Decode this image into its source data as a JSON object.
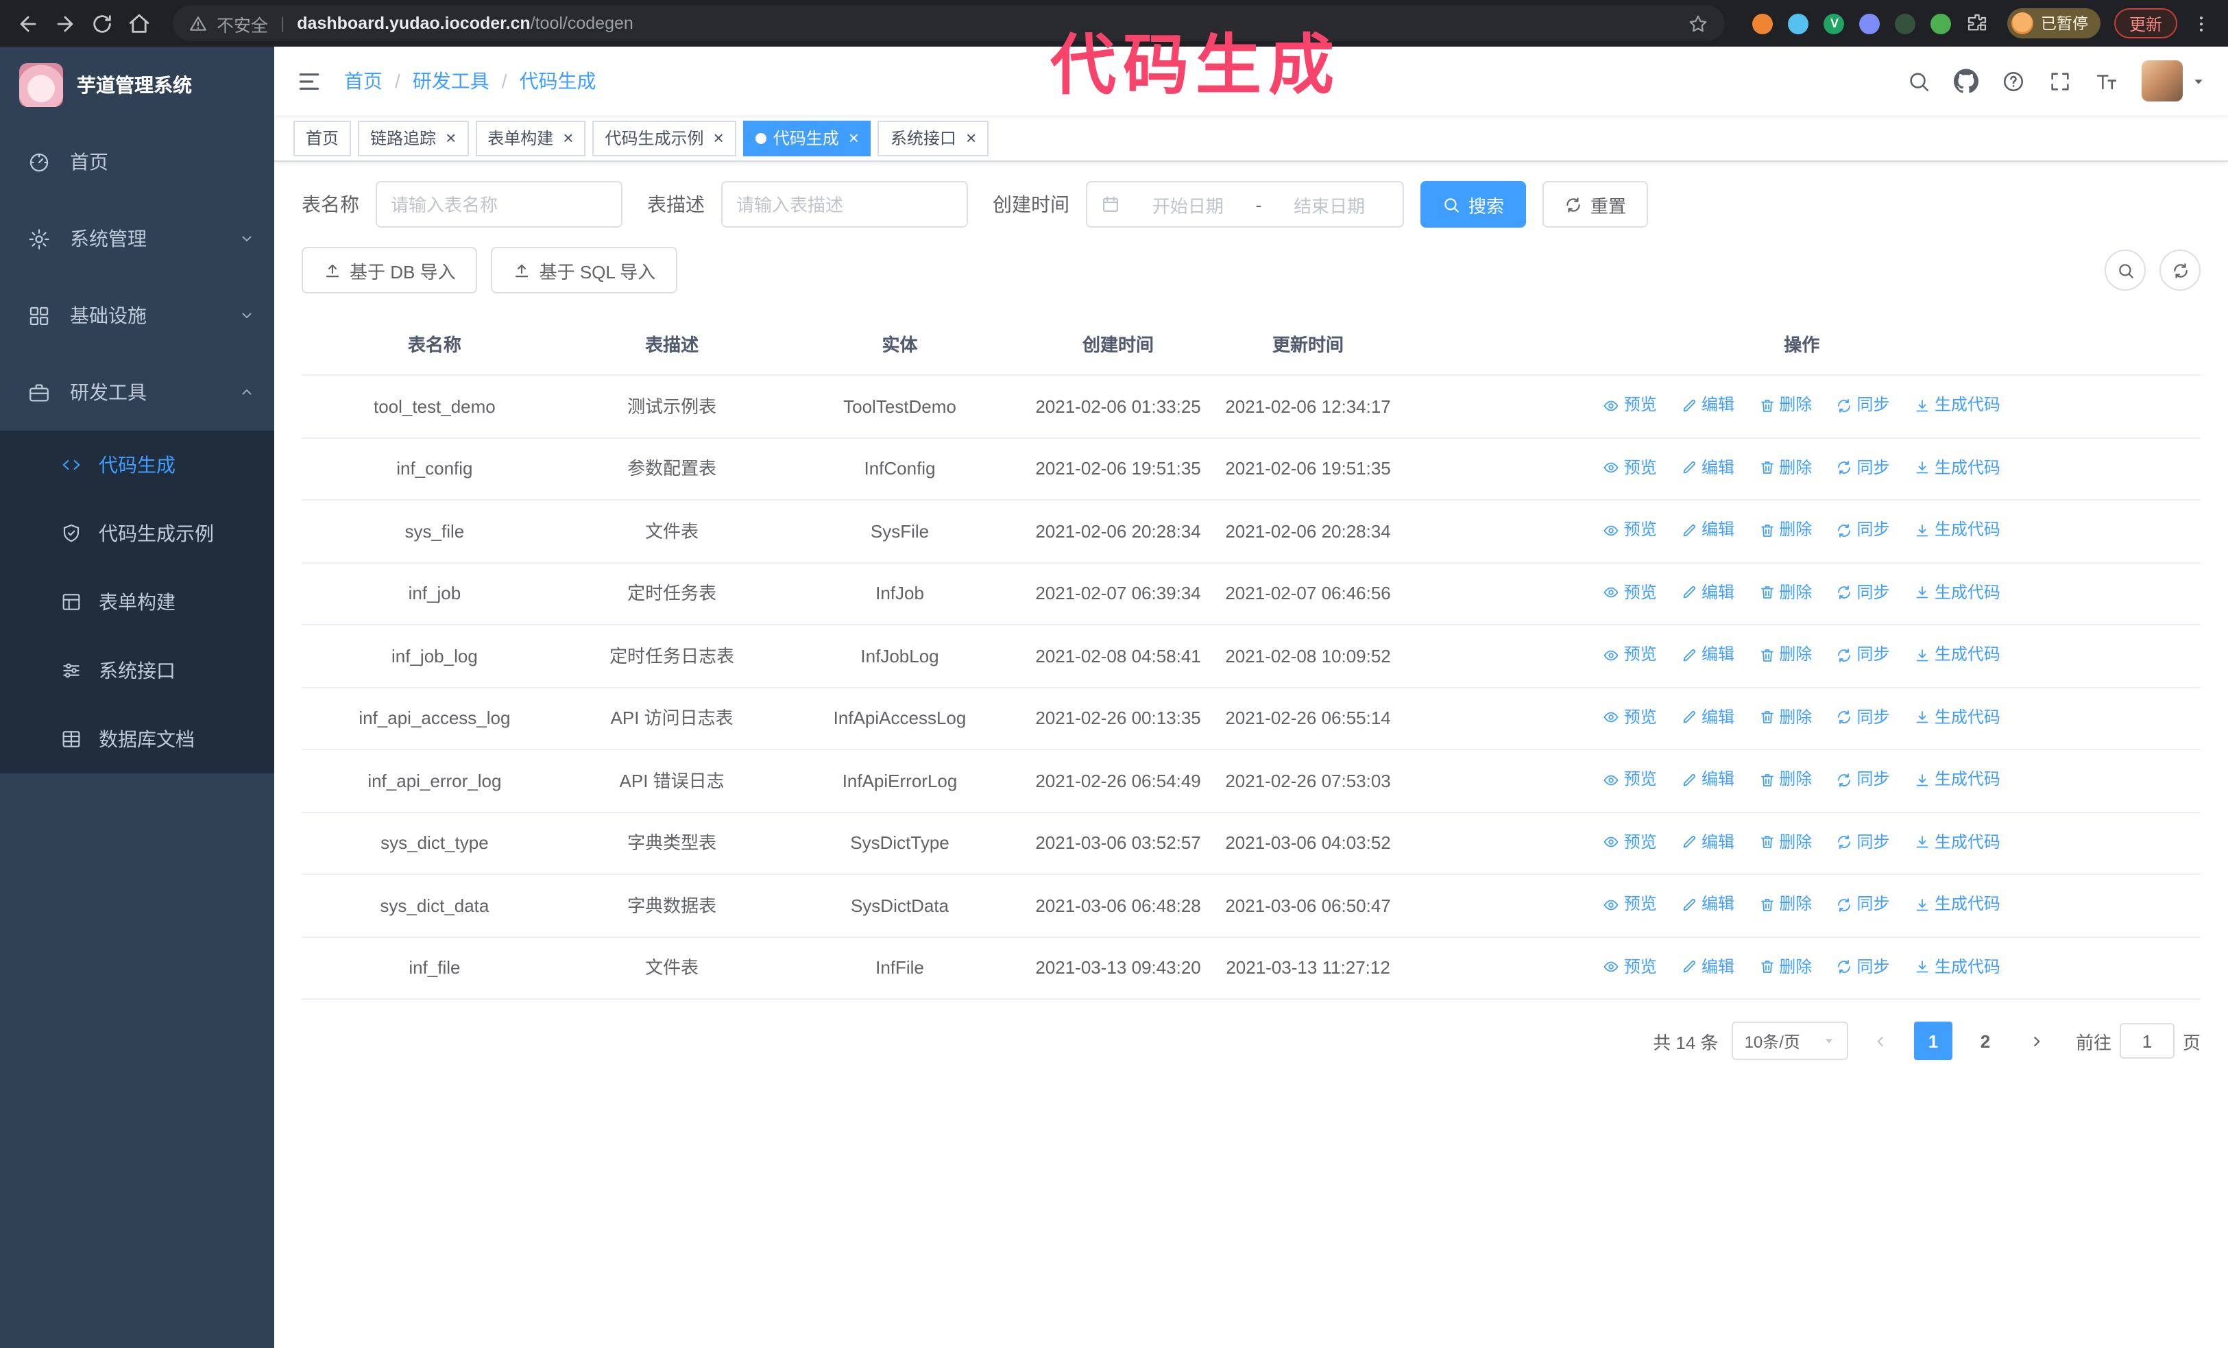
{
  "colors": {
    "accent": "#409eff",
    "sidebar_bg": "#304156",
    "submenu_bg": "#1f2d3d"
  },
  "annotation": {
    "text": "代码生成",
    "color": "#f8436b"
  },
  "browser": {
    "security_label": "不安全",
    "url_separator": "|",
    "url_host": "dashboard.yudao.iocoder.cn",
    "url_path": "/tool/codegen",
    "paused_badge": "已暂停",
    "update_button": "更新",
    "extensions": [
      {
        "name": "hamster-extension-icon",
        "color": "#ef8432",
        "letter": ""
      },
      {
        "name": "drop-extension-icon",
        "color": "#55c1f0",
        "letter": ""
      },
      {
        "name": "v-extension-icon",
        "color": "#1fa463",
        "letter": "V"
      },
      {
        "name": "contacts-extension-icon",
        "color": "#7c8cf8",
        "letter": ""
      },
      {
        "name": "capture-extension-icon",
        "color": "#35523f",
        "letter": ""
      },
      {
        "name": "leaf-extension-icon",
        "color": "#4caf50",
        "letter": ""
      },
      {
        "name": "puzzle-extension-icon",
        "color": "#c4c7c5",
        "letter": "",
        "shape": "puzzle"
      }
    ]
  },
  "app": {
    "title": "芋道管理系统"
  },
  "breadcrumb": {
    "separator": "/",
    "items": [
      "首页",
      "研发工具",
      "代码生成"
    ]
  },
  "sidebar": {
    "items": [
      {
        "label": "首页",
        "icon": "dashboard-icon"
      },
      {
        "label": "系统管理",
        "icon": "gear-icon",
        "chevron": "down"
      },
      {
        "label": "基础设施",
        "icon": "grid-icon",
        "chevron": "down"
      },
      {
        "label": "研发工具",
        "icon": "toolbox-icon",
        "chevron": "up",
        "expanded": true,
        "children": [
          {
            "label": "代码生成",
            "icon": "code-icon",
            "active": true
          },
          {
            "label": "代码生成示例",
            "icon": "shield-check-icon"
          },
          {
            "label": "表单构建",
            "icon": "form-icon"
          },
          {
            "label": "系统接口",
            "icon": "sliders-icon"
          },
          {
            "label": "数据库文档",
            "icon": "table-icon"
          }
        ]
      }
    ]
  },
  "tabs": [
    {
      "label": "首页",
      "closable": false,
      "active": false
    },
    {
      "label": "链路追踪",
      "closable": true,
      "active": false
    },
    {
      "label": "表单构建",
      "closable": true,
      "active": false
    },
    {
      "label": "代码生成示例",
      "closable": true,
      "active": false
    },
    {
      "label": "代码生成",
      "closable": true,
      "active": true
    },
    {
      "label": "系统接口",
      "closable": true,
      "active": false
    }
  ],
  "filters": {
    "table_name_label": "表名称",
    "table_name_placeholder": "请输入表名称",
    "table_desc_label": "表描述",
    "table_desc_placeholder": "请输入表描述",
    "create_time_label": "创建时间",
    "start_date_placeholder": "开始日期",
    "range_separator": "-",
    "end_date_placeholder": "结束日期",
    "search_button": "搜索",
    "reset_button": "重置"
  },
  "toolbar": {
    "import_db_button": "基于 DB 导入",
    "import_sql_button": "基于 SQL 导入"
  },
  "table": {
    "columns": [
      "表名称",
      "表描述",
      "实体",
      "创建时间",
      "更新时间",
      "操作"
    ],
    "row_actions": [
      "预览",
      "编辑",
      "删除",
      "同步",
      "生成代码"
    ],
    "rows": [
      {
        "name": "tool_test_demo",
        "description": "测试示例表",
        "entity": "ToolTestDemo",
        "create_time": "2021-02-06 01:33:25",
        "update_time": "2021-02-06 12:34:17"
      },
      {
        "name": "inf_config",
        "description": "参数配置表",
        "entity": "InfConfig",
        "create_time": "2021-02-06 19:51:35",
        "update_time": "2021-02-06 19:51:35"
      },
      {
        "name": "sys_file",
        "description": "文件表",
        "entity": "SysFile",
        "create_time": "2021-02-06 20:28:34",
        "update_time": "2021-02-06 20:28:34"
      },
      {
        "name": "inf_job",
        "description": "定时任务表",
        "entity": "InfJob",
        "create_time": "2021-02-07 06:39:34",
        "update_time": "2021-02-07 06:46:56"
      },
      {
        "name": "inf_job_log",
        "description": "定时任务日志表",
        "entity": "InfJobLog",
        "create_time": "2021-02-08 04:58:41",
        "update_time": "2021-02-08 10:09:52"
      },
      {
        "name": "inf_api_access_log",
        "description": "API 访问日志表",
        "entity": "InfApiAccessLog",
        "create_time": "2021-02-26 00:13:35",
        "update_time": "2021-02-26 06:55:14"
      },
      {
        "name": "inf_api_error_log",
        "description": "API 错误日志",
        "entity": "InfApiErrorLog",
        "create_time": "2021-02-26 06:54:49",
        "update_time": "2021-02-26 07:53:03"
      },
      {
        "name": "sys_dict_type",
        "description": "字典类型表",
        "entity": "SysDictType",
        "create_time": "2021-03-06 03:52:57",
        "update_time": "2021-03-06 04:03:52"
      },
      {
        "name": "sys_dict_data",
        "description": "字典数据表",
        "entity": "SysDictData",
        "create_time": "2021-03-06 06:48:28",
        "update_time": "2021-03-06 06:50:47"
      },
      {
        "name": "inf_file",
        "description": "文件表",
        "entity": "InfFile",
        "create_time": "2021-03-13 09:43:20",
        "update_time": "2021-03-13 11:27:12"
      }
    ]
  },
  "pagination": {
    "total": "共 14 条",
    "page_size": "10条/页",
    "pages": [
      "1",
      "2"
    ],
    "active_page": "1",
    "goto_prefix": "前往",
    "goto_value": "1",
    "goto_suffix": "页"
  }
}
